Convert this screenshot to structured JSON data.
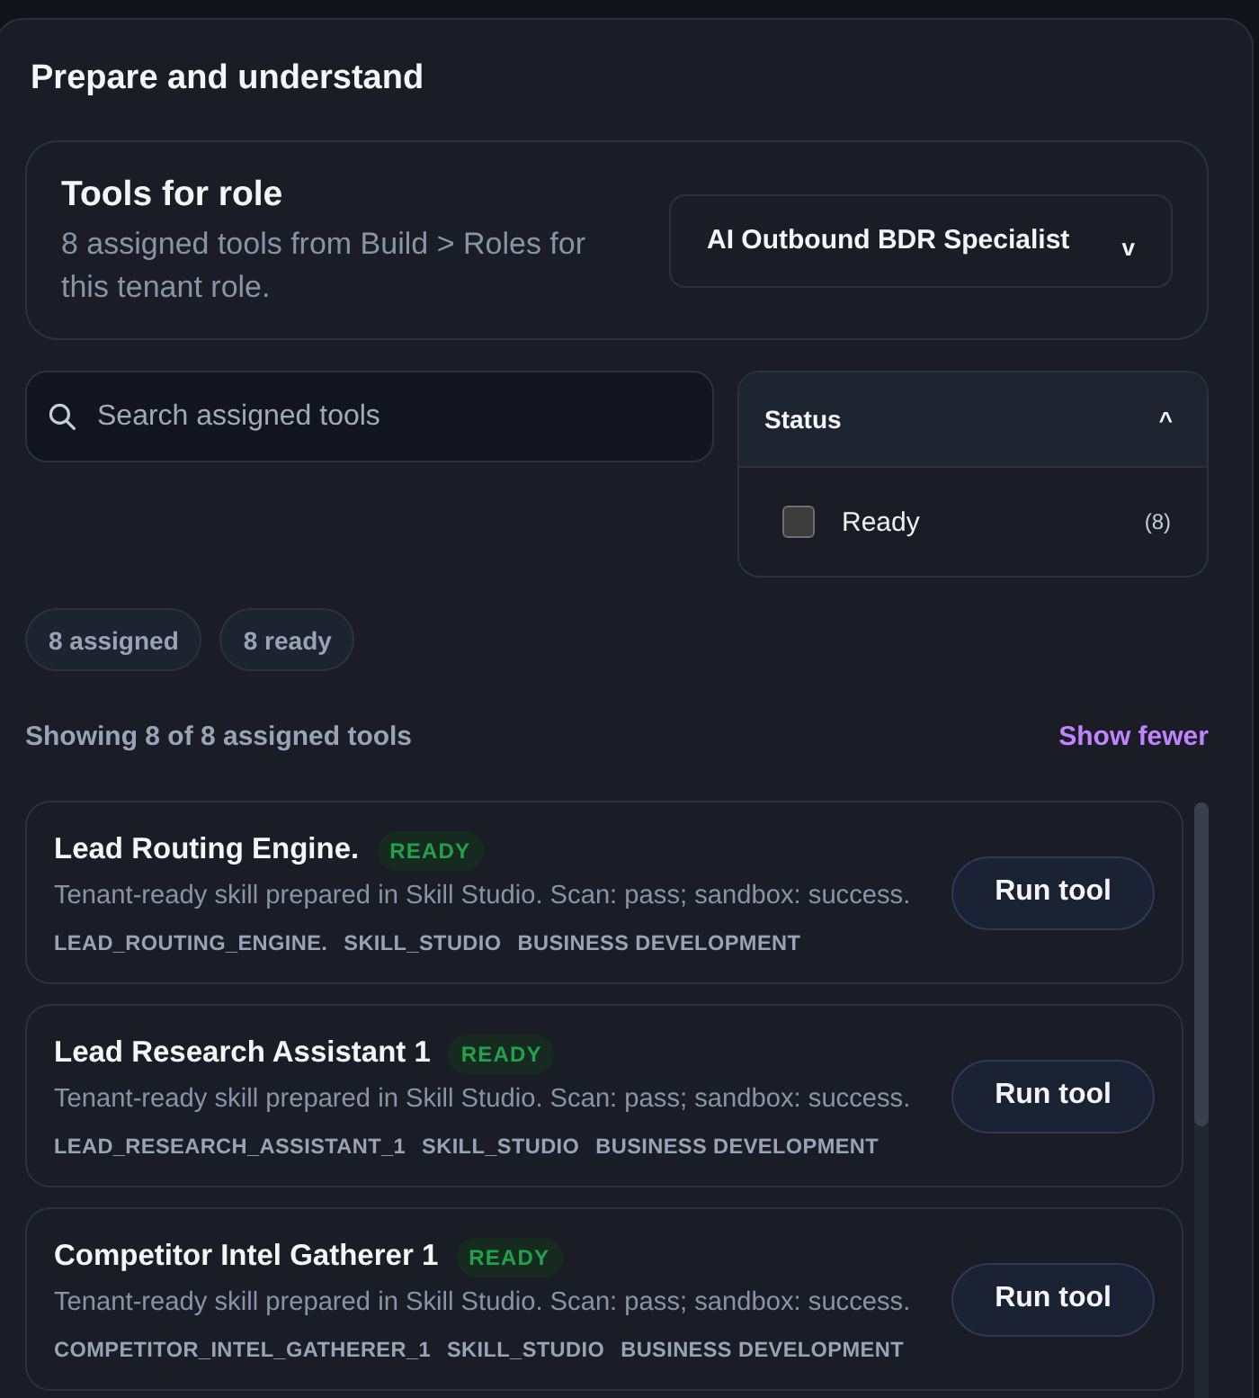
{
  "section": {
    "title": "Prepare and understand"
  },
  "role_card": {
    "title": "Tools for role",
    "description": "8 assigned tools from Build > Roles for this tenant role.",
    "role_select": {
      "value": "AI Outbound BDR Specialist",
      "caret": "v"
    }
  },
  "search": {
    "placeholder": "Search assigned tools"
  },
  "status_filter": {
    "title": "Status",
    "caret": "^",
    "expanded": true,
    "options": [
      {
        "label": "Ready",
        "count": "(8)",
        "checked": false
      }
    ]
  },
  "summary_chips": [
    "8 assigned",
    "8 ready"
  ],
  "results": {
    "text": "Showing 8 of 8 assigned tools",
    "toggle": "Show fewer"
  },
  "tools": [
    {
      "name": "Lead Routing Engine.",
      "status": "READY",
      "description": "Tenant-ready skill prepared in Skill Studio. Scan: pass; sandbox: success.",
      "tags": [
        "LEAD_ROUTING_ENGINE.",
        "SKILL_STUDIO",
        "BUSINESS DEVELOPMENT"
      ],
      "action": "Run tool"
    },
    {
      "name": "Lead Research Assistant 1",
      "status": "READY",
      "description": "Tenant-ready skill prepared in Skill Studio. Scan: pass; sandbox: success.",
      "tags": [
        "LEAD_RESEARCH_ASSISTANT_1",
        "SKILL_STUDIO",
        "BUSINESS DEVELOPMENT"
      ],
      "action": "Run tool"
    },
    {
      "name": "Competitor Intel Gatherer 1",
      "status": "READY",
      "description": "Tenant-ready skill prepared in Skill Studio. Scan: pass; sandbox: success.",
      "tags": [
        "COMPETITOR_INTEL_GATHERER_1",
        "SKILL_STUDIO",
        "BUSINESS DEVELOPMENT"
      ],
      "action": "Run tool"
    }
  ]
}
